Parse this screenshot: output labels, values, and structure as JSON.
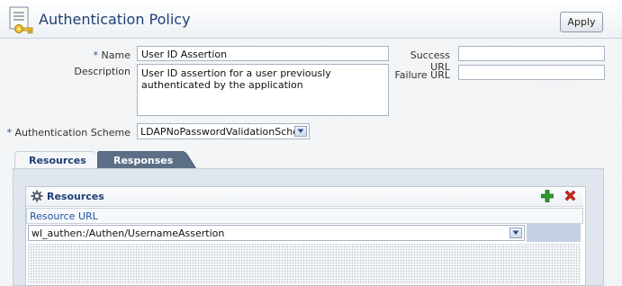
{
  "header": {
    "title": "Authentication Policy",
    "apply_label": "Apply"
  },
  "form": {
    "name": {
      "required_mark": "*",
      "label": "Name",
      "value": "User ID Assertion"
    },
    "description": {
      "label": "Description",
      "value": "User ID assertion for a user previously authenticated by the application"
    },
    "success_url": {
      "label": "Success URL",
      "value": ""
    },
    "failure_url": {
      "label": "Failure URL",
      "value": ""
    },
    "auth_scheme": {
      "required_mark": "*",
      "label": "Authentication Scheme",
      "value": "LDAPNoPasswordValidationScheme"
    }
  },
  "tabs": [
    {
      "label": "Resources",
      "selected": true
    },
    {
      "label": "Responses",
      "selected": false
    }
  ],
  "resources_panel": {
    "title": "Resources",
    "column_header": "Resource URL",
    "rows": [
      {
        "url": "wl_authen:/Authen/UsernameAssertion"
      }
    ]
  },
  "icons": {
    "policy": "policy-document-key-icon",
    "gear": "gear-icon",
    "add": "add-icon",
    "remove": "remove-icon"
  },
  "colors": {
    "title": "#1f3f74",
    "add": "#2e9a2e",
    "remove": "#d02a1e",
    "selected_row": "#c5d1e2"
  }
}
